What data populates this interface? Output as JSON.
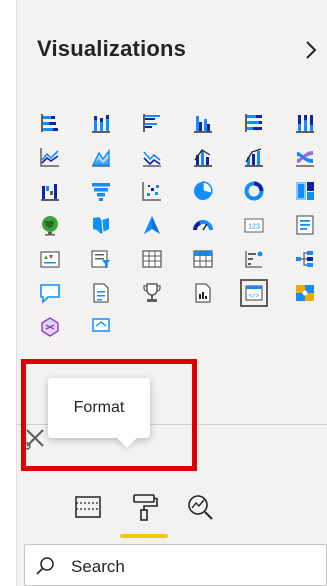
{
  "panel": {
    "title": "Visualizations",
    "collapse_icon": "chevron-right-icon"
  },
  "visual_icons": [
    [
      "stacked-bar-chart-icon",
      "stacked-column-chart-icon",
      "clustered-bar-chart-icon",
      "clustered-column-chart-icon",
      "100-stacked-bar-chart-icon",
      "100-stacked-column-chart-icon"
    ],
    [
      "line-chart-icon",
      "area-chart-icon",
      "stacked-area-chart-icon",
      "line-and-stacked-column-chart-icon",
      "line-and-clustered-column-chart-icon",
      "ribbon-chart-icon"
    ],
    [
      "waterfall-chart-icon",
      "funnel-icon",
      "scatter-chart-icon",
      "pie-chart-icon",
      "donut-chart-icon",
      "treemap-icon"
    ],
    [
      "map-icon",
      "filled-map-icon",
      "azure-map-icon",
      "gauge-icon",
      "card-icon",
      "multi-row-card-icon"
    ],
    [
      "kpi-icon",
      "slicer-icon",
      "table-icon",
      "matrix-icon",
      "key-influencers-icon",
      "decomposition-tree-icon"
    ],
    [
      "qa-icon",
      "smart-narrative-icon",
      "metrics-icon",
      "paginated-report-icon",
      "html-content-visual-icon",
      "custom-visual-icon"
    ],
    [
      "custom-visual-2-icon",
      "custom-visual-3-icon"
    ]
  ],
  "tooltip": {
    "text": "Format"
  },
  "tabs": [
    {
      "name": "build-visual-tab",
      "icon": "fields-well-icon"
    },
    {
      "name": "format-visual-tab",
      "icon": "paint-roller-icon",
      "active": true
    },
    {
      "name": "analytics-tab",
      "icon": "analytics-magnifier-icon"
    }
  ],
  "search": {
    "placeholder": "Search",
    "icon": "search-icon"
  },
  "colors": {
    "accent_yellow": "#f2c811",
    "highlight_red": "#e00000",
    "panel_bg": "#f3f2f1"
  }
}
